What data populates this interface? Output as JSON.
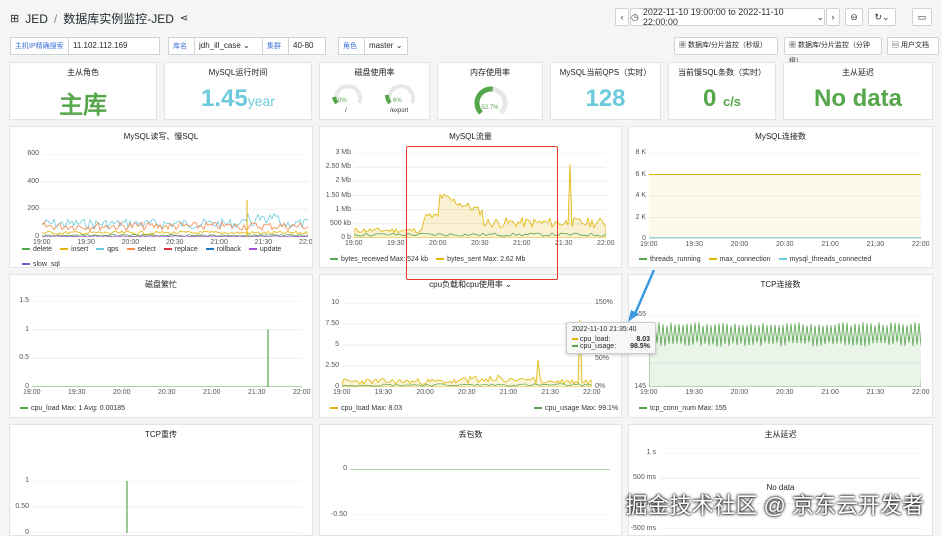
{
  "header": {
    "app": "JED",
    "sep": "/",
    "title": "数据库实例监控-JED",
    "time_range": "2022-11-10 19:00:00 to 2022-11-10 22:00:00"
  },
  "filters": {
    "host_label": "主机IP精确搜索",
    "host_value": "11.102.112.169",
    "db_label": "库名",
    "db_value": "jdh_ill_case",
    "cluster_label": "集群",
    "cluster_value": "40-80",
    "role_label": "角色",
    "role_value": "master",
    "link1": "数据库/分片监控（秒级）",
    "link2": "数据库/分片监控（分钟级）",
    "link3": "用户文档"
  },
  "stats": [
    {
      "title": "主从角色",
      "value": "主库",
      "unit": "",
      "color": "#56a64b"
    },
    {
      "title": "MySQL运行时间",
      "value": "1.45",
      "unit": "year",
      "color": "#6ccadc"
    },
    {
      "title": "磁盘使用率",
      "value": "",
      "unit": "",
      "color": "#56a64b"
    },
    {
      "title": "内存使用率",
      "value": "",
      "unit": "",
      "color": "#56a64b"
    },
    {
      "title": "MySQL当前QPS（实时）",
      "value": "128",
      "unit": "",
      "color": "#6ccadc"
    },
    {
      "title": "当前慢SQL条数（实时）",
      "value": "0",
      "unit": "c/s",
      "color": "#56a64b"
    },
    {
      "title": "主从延迟",
      "value": "No data",
      "unit": "",
      "color": "#56a64b"
    }
  ],
  "disk": {
    "g1": "0%",
    "g1_label": "/",
    "g2": "6%",
    "g2_label": "/export"
  },
  "memory": {
    "value": "52.7%",
    "fraction": 0.527
  },
  "panels": {
    "rw": {
      "title": "MySQL读写、慢SQL",
      "ylabels": [
        "600",
        "400",
        "200",
        "0"
      ],
      "xlabels": [
        "19:00",
        "19:30",
        "20:00",
        "20:30",
        "21:00",
        "21:30",
        "22:00"
      ],
      "legend": [
        {
          "name": "delete",
          "color": "#56a64b"
        },
        {
          "name": "insert",
          "color": "#e0b400"
        },
        {
          "name": "qps",
          "color": "#6ccadc"
        },
        {
          "name": "select",
          "color": "#f2884d"
        },
        {
          "name": "replace",
          "color": "#e02f44"
        },
        {
          "name": "rollback",
          "color": "#1f78c1"
        },
        {
          "name": "update",
          "color": "#a352cc"
        },
        {
          "name": "slow_sql",
          "color": "#7b5fc8"
        }
      ]
    },
    "flow": {
      "title": "MySQL流量",
      "ylabels": [
        "3 Mb",
        "2.50 Mb",
        "2 Mb",
        "1.50 Mb",
        "1 Mb",
        "500 kb",
        "0 b"
      ],
      "xlabels": [
        "19:00",
        "19:30",
        "20:00",
        "20:30",
        "21:00",
        "21:30",
        "22:00"
      ],
      "legend": [
        {
          "name": "bytes_received  Max: 524 kb",
          "color": "#56a64b"
        },
        {
          "name": "bytes_sent  Max: 2.62 Mb",
          "color": "#e0b400"
        }
      ]
    },
    "conn": {
      "title": "MySQL连接数",
      "ylabels": [
        "8 K",
        "6 K",
        "4 K",
        "2 K",
        "0"
      ],
      "xlabels": [
        "19:00",
        "19:30",
        "20:00",
        "20:30",
        "21:00",
        "21:30",
        "22:00"
      ],
      "legend": [
        {
          "name": "threads_running",
          "color": "#56a64b"
        },
        {
          "name": "max_connection",
          "color": "#e0b400"
        },
        {
          "name": "mysql_threads_connected",
          "color": "#6ccadc"
        }
      ]
    },
    "disk_busy": {
      "title": "磁盘繁忙",
      "ylabels": [
        "1.5",
        "1",
        "0.5",
        "0"
      ],
      "xlabels": [
        "19:00",
        "19:30",
        "20:00",
        "20:30",
        "21:00",
        "21:30",
        "22:00"
      ],
      "legend": [
        {
          "name": "cpu_load  Max: 1  Avg: 0.00185",
          "color": "#56a64b"
        }
      ]
    },
    "cpu": {
      "title": "cpu负载和cpu使用率",
      "ylabels": [
        "10",
        "7.50",
        "5",
        "2.50",
        "0"
      ],
      "ylabels_r": [
        "150%",
        "100%",
        "50%",
        "0%"
      ],
      "xlabels": [
        "19:00",
        "19:30",
        "20:00",
        "20:30",
        "21:00",
        "21:30",
        "22:00"
      ],
      "legend_left": {
        "name": "cpu_load  Max: 8.03",
        "color": "#e0b400"
      },
      "legend_right": {
        "name": "cpu_usage  Max: 99.1%",
        "color": "#56a64b"
      },
      "tooltip": {
        "time": "2022-11-10 21:35:40",
        "r1_name": "cpu_load:",
        "r1_val": "8.03",
        "r2_name": "cpu_usage:",
        "r2_val": "98.5%"
      }
    },
    "tcp": {
      "title": "TCP连接数",
      "ylabels": [
        "155",
        "148",
        "145"
      ],
      "xlabels": [
        "19:00",
        "19:30",
        "20:00",
        "20:30",
        "21:00",
        "21:30",
        "22:00"
      ],
      "legend": [
        {
          "name": "tcp_conn_num  Max: 155",
          "color": "#56a64b"
        }
      ]
    },
    "retrans": {
      "title": "TCP重传",
      "ylabels": [
        "1",
        "0.50",
        "0"
      ]
    },
    "drop": {
      "title": "丢包数",
      "ylabels": [
        "0",
        "-0.50"
      ]
    },
    "delay": {
      "title": "主从延迟",
      "ylabels": [
        "1 s",
        "500 ms",
        "0 ms",
        "-500 ms"
      ],
      "nodata": "No data"
    }
  },
  "watermark": "掘金技术社区 @ 京东云开发者"
}
